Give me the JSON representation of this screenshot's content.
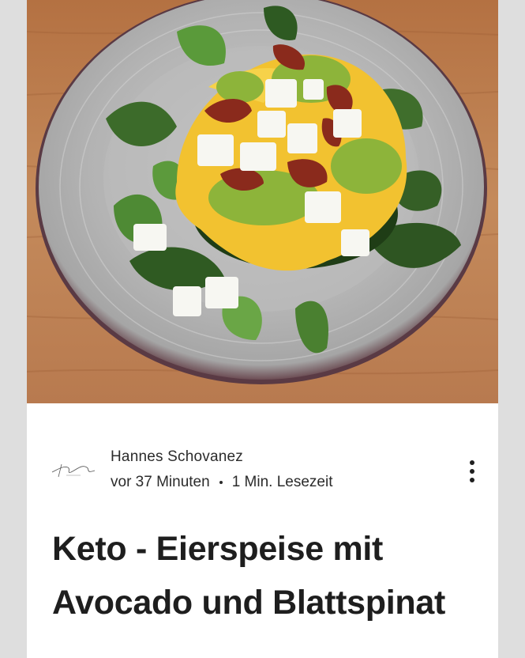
{
  "post": {
    "hero_image": "keto-omelette-avocado-feta-spinach-photo",
    "author": {
      "name": "Hannes Schovanez",
      "logo": "signature-logo",
      "logo_text": "Hannes Schovanez"
    },
    "meta": {
      "time_ago": "vor 37 Minuten",
      "read_time": "1 Min. Lesezeit"
    },
    "more_icon": "vertical-dots-icon",
    "title": "Keto - Eierspeise mit Avocado und Blattspinat"
  },
  "colors": {
    "page_background": "#dedede",
    "card_background": "#ffffff",
    "text": "#2b2b2b",
    "title": "#1e1e1e"
  }
}
